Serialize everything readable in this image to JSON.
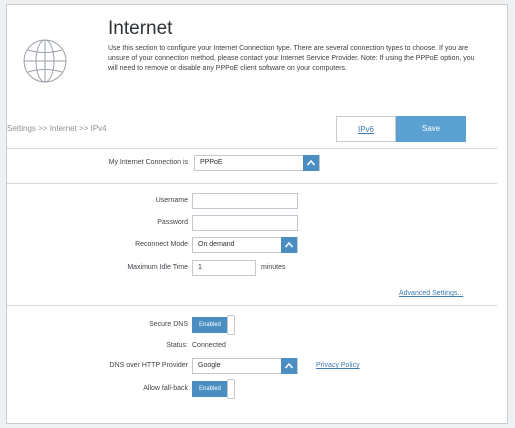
{
  "header": {
    "title": "Internet",
    "description": "Use this section to configure your Internet Connection type. There are several connection types to choose. If you are unsure of your connection method, please contact your Internet Service Provider. Note: If using the PPPoE option, you will need to remove or disable any PPPoE client software on your computers.",
    "icon": "globe-icon"
  },
  "breadcrumb": "Settings >> Internet >> IPv4",
  "toolbar": {
    "ipv6_label": "IPv6",
    "save_label": "Save"
  },
  "connection": {
    "label": "My Internet Connection is",
    "value": "PPPoE"
  },
  "pppoe": {
    "username_label": "Username",
    "username_value": "",
    "password_label": "Password",
    "password_value": "",
    "reconnect_label": "Reconnect Mode",
    "reconnect_value": "On demand",
    "idle_label": "Maximum Idle Time",
    "idle_value": "1",
    "idle_unit": "minutes"
  },
  "advanced_settings": "Advanced Settings...",
  "dns": {
    "secure_label": "Secure DNS",
    "secure_toggle": "Enabled",
    "status_label": "Status:",
    "status_value": "Connected",
    "provider_label": "DNS over HTTP Provider",
    "provider_value": "Google",
    "privacy_link": "Privacy Policy",
    "fallback_label": "Allow fall-back",
    "fallback_toggle": "Enabled"
  },
  "colors": {
    "accent": "#4a8ec2",
    "save_button": "#5aa1d1",
    "link": "#3f79b6"
  }
}
